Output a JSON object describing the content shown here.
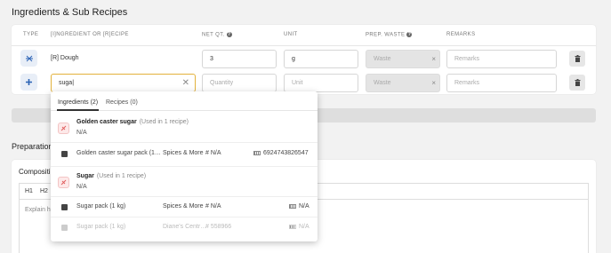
{
  "page": {
    "section_title": "Ingredients & Sub Recipes",
    "prep_title": "Preparation",
    "composition_title": "Composition"
  },
  "table": {
    "headers": {
      "type": "TYPE",
      "ingredient": "[I]NGREDIENT OR [R]ECIPE",
      "net_qty": "NET QT.",
      "unit": "UNIT",
      "prep_waste": "PREP. WASTE",
      "remarks": "REMARKS"
    },
    "row1": {
      "name": "[R] Dough",
      "qty": "3",
      "unit": "g",
      "waste_placeholder": "Waste",
      "remarks_placeholder": "Remarks"
    },
    "row2": {
      "search_value": "suga",
      "qty_placeholder": "Quantity",
      "unit_placeholder": "Unit",
      "waste_placeholder": "Waste",
      "remarks_placeholder": "Remarks"
    },
    "clear_glyph": "✕",
    "small_x": "×"
  },
  "dropdown": {
    "tab_ingredients": "Ingredients (2)",
    "tab_recipes": "Recipes (0)",
    "items": [
      {
        "name": "Golden caster sugar",
        "used": "(Used in 1 recipe)",
        "sub": "N/A",
        "pack": {
          "name": "Golden caster sugar pack (1…",
          "supplier": "Spices & More",
          "code": "# N/A",
          "barcode": "6924743826547"
        }
      },
      {
        "name": "Sugar",
        "used": "(Used in 1 recipe)",
        "sub": "N/A",
        "packs": [
          {
            "name": "Sugar pack (1 kg)",
            "supplier": "Spices & More",
            "code": "# N/A",
            "barcode": "N/A"
          },
          {
            "name": "Sugar pack (1 kg)",
            "supplier": "Diane's Centr…",
            "code": "# 558966",
            "barcode": "N/A"
          }
        ]
      }
    ]
  },
  "editor": {
    "h1": "H1",
    "h2": "H2",
    "placeholder": "Explain h"
  },
  "colors": {
    "focus_border": "#e3b23c",
    "primary_icon": "#2b63b5",
    "ingredient_icon": "#e05b5b"
  }
}
